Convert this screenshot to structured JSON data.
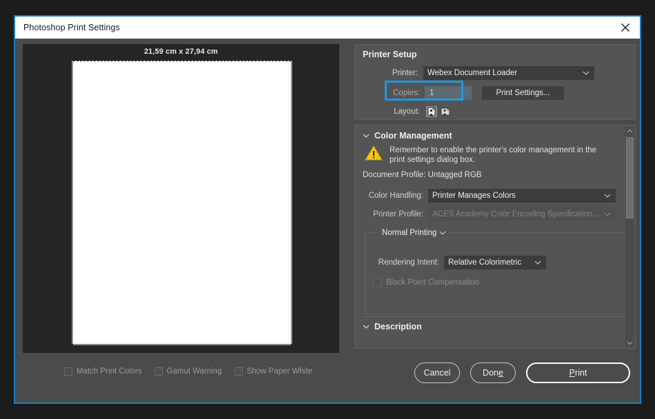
{
  "window": {
    "title": "Photoshop Print Settings",
    "close_icon": "close-icon"
  },
  "preview": {
    "paper_size_label": "21,59 cm x 27,94 cm"
  },
  "proof_options": [
    {
      "label": "Match Print Colors",
      "checked": false
    },
    {
      "label": "Gamut Warning",
      "checked": false
    },
    {
      "label": "Show Paper White",
      "checked": false
    }
  ],
  "printer_setup": {
    "title": "Printer Setup",
    "printer_label": "Printer:",
    "printer_value": "Webex Document Loader",
    "copies_label": "Copies:",
    "copies_value": "1",
    "print_settings_button": "Print Settings...",
    "layout_label": "Layout:",
    "layout_portrait_icon": "portrait-layout-icon",
    "layout_landscape_icon": "landscape-layout-icon",
    "highlight_color": "#1a9ae0"
  },
  "color_management": {
    "title": "Color Management",
    "warning_icon": "warning-triangle-icon",
    "warning_text": "Remember to enable the printer's color management in the print settings dialog box.",
    "document_profile": "Document Profile: Untagged RGB",
    "color_handling_label": "Color Handling:",
    "color_handling_value": "Printer Manages Colors",
    "printer_profile_label": "Printer Profile:",
    "printer_profile_value": "ACES Academy Color Encoding Specification...",
    "normal_printing_value": "Normal Printing",
    "rendering_intent_label": "Rendering Intent:",
    "rendering_intent_value": "Relative Colorimetric",
    "black_point_label": "Black Point Compensation",
    "black_point_checked": false,
    "description_title": "Description"
  },
  "footer": {
    "cancel": "Cancel",
    "done_prefix": "Don",
    "done_accel": "e",
    "print_accel": "P",
    "print_suffix": "rint"
  },
  "annotation": {
    "arrow_color": "#1a9ae0",
    "arrow_icon": "down-arrow-annotation-icon"
  }
}
